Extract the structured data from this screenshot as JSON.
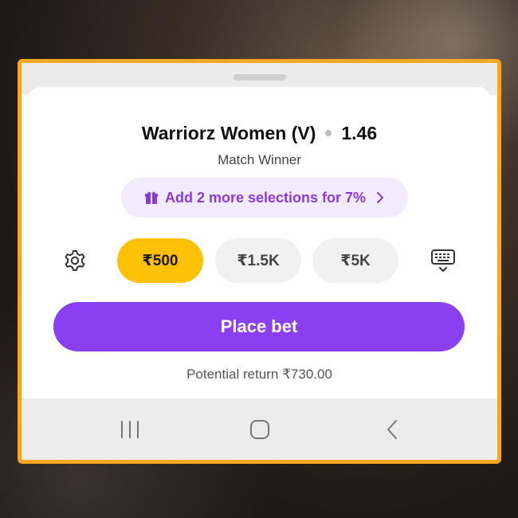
{
  "selection": {
    "name": "Warriorz Women (V)",
    "odds": "1.46",
    "market": "Match Winner"
  },
  "promo": {
    "text": "Add 2 more selections for 7%",
    "icon": "gift-icon",
    "chevron_icon": "chevron-right-icon"
  },
  "stakes": {
    "settings_icon": "gear-icon",
    "keyboard_icon": "keyboard-icon",
    "options": [
      {
        "label": "₹500",
        "selected": true
      },
      {
        "label": "₹1.5K",
        "selected": false
      },
      {
        "label": "₹5K",
        "selected": false
      }
    ]
  },
  "place_bet": {
    "label": "Place bet"
  },
  "potential_return": "Potential return ₹730.00",
  "nav": {
    "recents_icon": "recents-icon",
    "home_icon": "home-icon",
    "back_icon": "back-icon"
  },
  "colors": {
    "frame_border": "#f5a623",
    "accent_purple": "#8b3ff2",
    "selected_chip": "#ffc107",
    "promo_bg": "#f2ebfb",
    "promo_text": "#8a3ad8"
  }
}
